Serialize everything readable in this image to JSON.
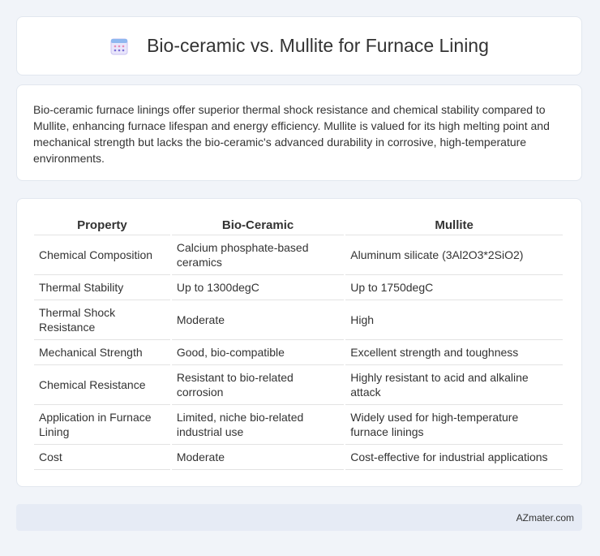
{
  "header": {
    "title": "Bio-ceramic vs. Mullite for Furnace Lining",
    "icon": "calendar-icon"
  },
  "intro": {
    "text": "Bio-ceramic furnace linings offer superior thermal shock resistance and chemical stability compared to Mullite, enhancing furnace lifespan and energy efficiency. Mullite is valued for its high melting point and mechanical strength but lacks the bio-ceramic's advanced durability in corrosive, high-temperature environments."
  },
  "table": {
    "headers": [
      "Property",
      "Bio-Ceramic",
      "Mullite"
    ],
    "rows": [
      [
        "Chemical Composition",
        "Calcium phosphate-based ceramics",
        "Aluminum silicate (3Al2O3*2SiO2)"
      ],
      [
        "Thermal Stability",
        "Up to 1300degC",
        "Up to 1750degC"
      ],
      [
        "Thermal Shock Resistance",
        "Moderate",
        "High"
      ],
      [
        "Mechanical Strength",
        "Good, bio-compatible",
        "Excellent strength and toughness"
      ],
      [
        "Chemical Resistance",
        "Resistant to bio-related corrosion",
        "Highly resistant to acid and alkaline attack"
      ],
      [
        "Application in Furnace Lining",
        "Limited, niche bio-related industrial use",
        "Widely used for high-temperature furnace linings"
      ],
      [
        "Cost",
        "Moderate",
        "Cost-effective for industrial applications"
      ]
    ]
  },
  "footer": {
    "brand": "AZmater.com"
  },
  "colors": {
    "background": "#f1f4f9",
    "card": "#ffffff",
    "footer": "#e6ebf5",
    "icon_accent": "#7b6fd6"
  }
}
